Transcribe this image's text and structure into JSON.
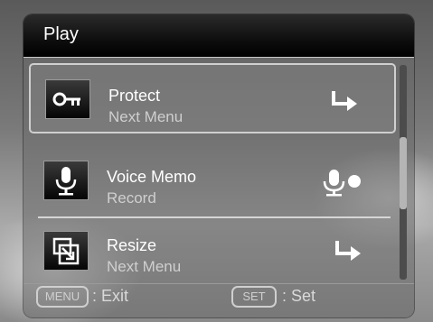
{
  "screen": {
    "title": "Play"
  },
  "menu": {
    "items": [
      {
        "label": "Protect",
        "sublabel": "Next Menu",
        "icon": "key-icon",
        "right_icon": "next-arrow-icon"
      },
      {
        "label": "Voice Memo",
        "sublabel": "Record",
        "icon": "microphone-icon",
        "right_icon": "record-mic-icon"
      },
      {
        "label": "Resize",
        "sublabel": "Next Menu",
        "icon": "resize-icon",
        "right_icon": "next-arrow-icon"
      }
    ],
    "selected_index": 0
  },
  "footer": {
    "menu_key": "MENU",
    "menu_action": ": Exit",
    "set_key": "SET",
    "set_action": ": Set"
  },
  "colors": {
    "title_bar": "#000000",
    "text": "#ffffff",
    "subtext": "#cfcfcf",
    "selection_border": "#cfcfcf"
  }
}
